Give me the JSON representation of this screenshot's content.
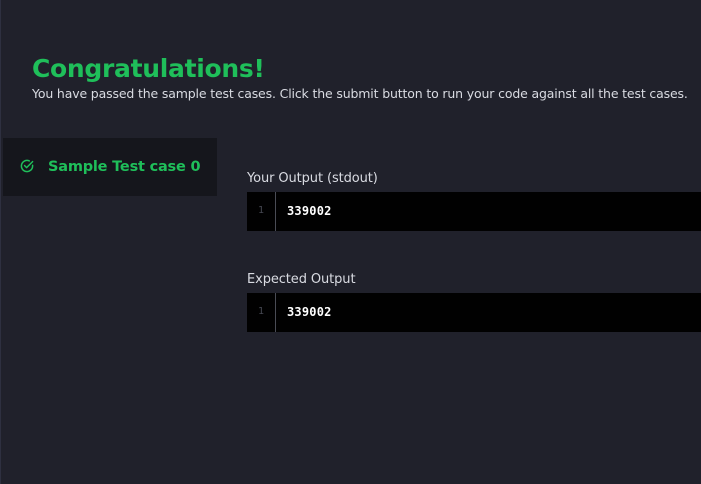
{
  "result": {
    "title": "Congratulations!",
    "message": "You have passed the sample test cases. Click the submit button to run your code against all the test cases."
  },
  "testcases": [
    {
      "label": "Sample Test case 0",
      "status_icon": "check-circle-icon",
      "status": "passed"
    }
  ],
  "your_output": {
    "label": "Your Output (stdout)",
    "lines": [
      {
        "number": "1",
        "text": "339002"
      }
    ]
  },
  "expected_output": {
    "label": "Expected Output",
    "lines": [
      {
        "number": "1",
        "text": "339002"
      }
    ]
  },
  "colors": {
    "background": "#20212b",
    "success": "#1fbf5a",
    "panel": "#15161c",
    "code_background": "#010101",
    "text": "#d9dbe2"
  }
}
